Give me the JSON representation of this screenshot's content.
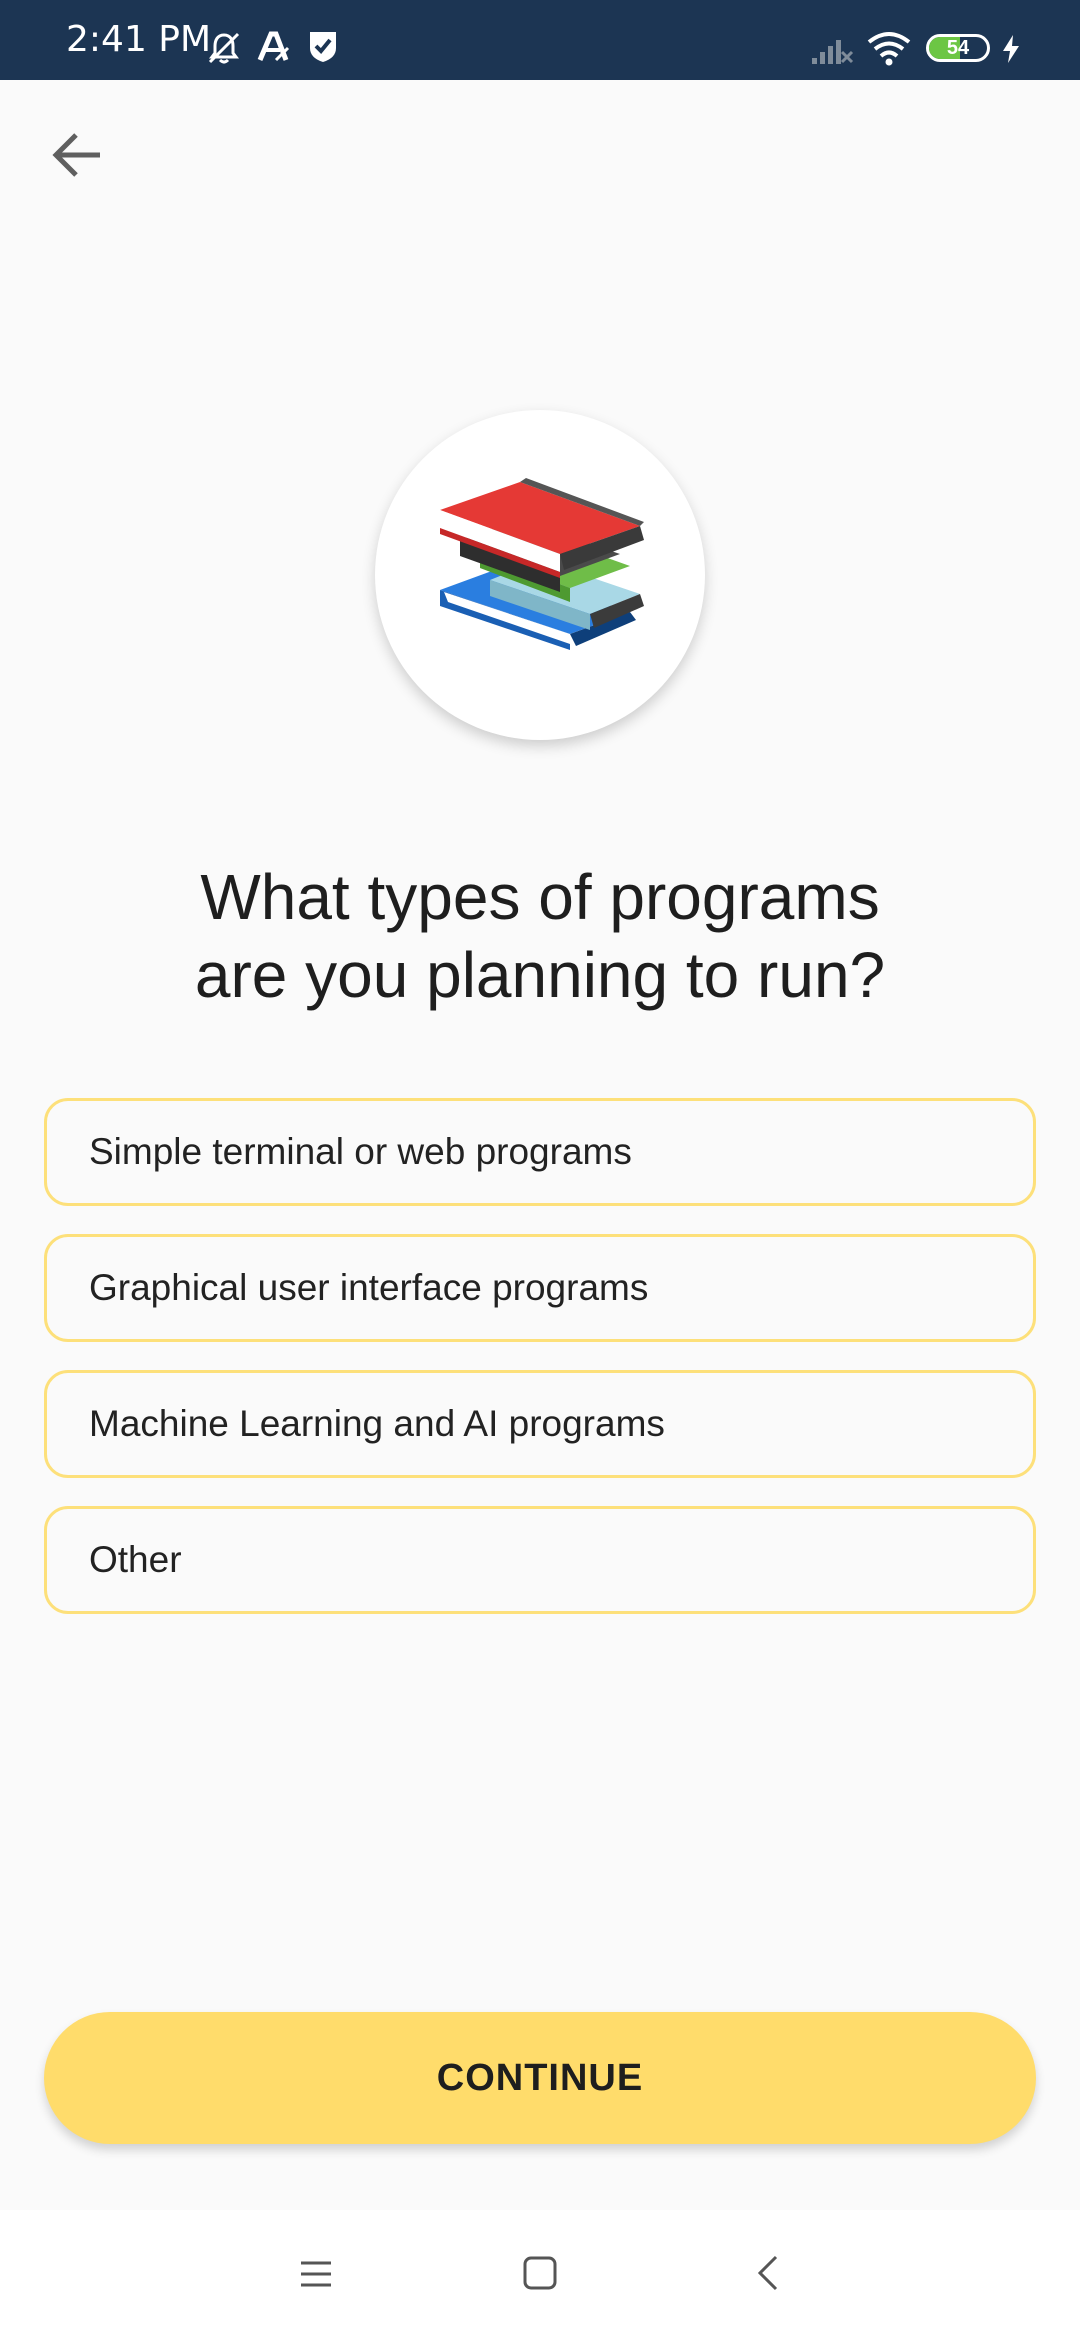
{
  "status_bar": {
    "time": "2:41 PM",
    "battery_percent": "54",
    "battery_level": 0.54,
    "icons": [
      "mute-bell-icon",
      "a-accessibility-icon",
      "shield-check-icon",
      "signal-icon",
      "wifi-icon",
      "battery-icon",
      "charging-icon"
    ],
    "background": "#1c3553"
  },
  "header": {
    "back_icon": "arrow-left-icon"
  },
  "hero": {
    "icon": "books-icon"
  },
  "question": {
    "line1": "What types of programs",
    "line2": "are you planning to run?"
  },
  "options": [
    {
      "label": "Simple terminal or web programs"
    },
    {
      "label": "Graphical user interface programs"
    },
    {
      "label": "Machine Learning and AI programs"
    },
    {
      "label": "Other"
    }
  ],
  "continue_button": {
    "label": "CONTINUE"
  },
  "nav_bar": {
    "icons": [
      "menu-icon",
      "home-square-icon",
      "back-chevron-icon"
    ]
  },
  "colors": {
    "accent": "#ffdc6b",
    "option_border": "#fde07a",
    "background": "#fafafa"
  }
}
